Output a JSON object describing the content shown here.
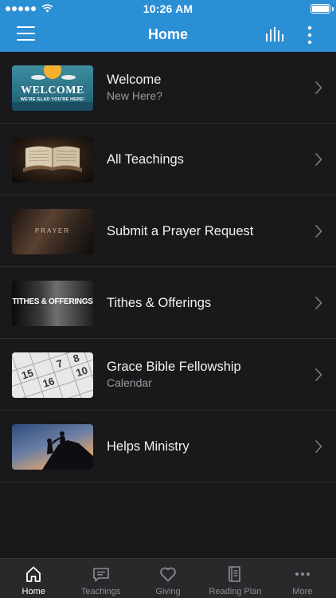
{
  "status_bar": {
    "time": "10:26 AM"
  },
  "header": {
    "title": "Home"
  },
  "items": [
    {
      "title": "Welcome",
      "subtitle": "New Here?",
      "thumb_text": "WELCOME",
      "thumb_subtext": "WE'RE GLAD YOU'RE HERE!"
    },
    {
      "title": "All Teachings",
      "subtitle": ""
    },
    {
      "title": "Submit a Prayer Request",
      "subtitle": "",
      "thumb_text": "PRAYER"
    },
    {
      "title": "Tithes & Offerings",
      "subtitle": "",
      "thumb_text": "TITHES & OFFERINGS"
    },
    {
      "title": "Grace Bible Fellowship",
      "subtitle": "Calendar",
      "thumb_numbers": [
        "15",
        "16",
        "10",
        "7",
        "8"
      ]
    },
    {
      "title": "Helps Ministry",
      "subtitle": ""
    }
  ],
  "tabs": [
    {
      "label": "Home",
      "icon": "home-icon",
      "active": true
    },
    {
      "label": "Teachings",
      "icon": "message-icon",
      "active": false
    },
    {
      "label": "Giving",
      "icon": "heart-icon",
      "active": false
    },
    {
      "label": "Reading Plan",
      "icon": "book-icon",
      "active": false
    },
    {
      "label": "More",
      "icon": "ellipsis-icon",
      "active": false
    }
  ],
  "colors": {
    "accent": "#2b8fd6",
    "background": "#19191b",
    "tab_bar": "#29292c"
  }
}
